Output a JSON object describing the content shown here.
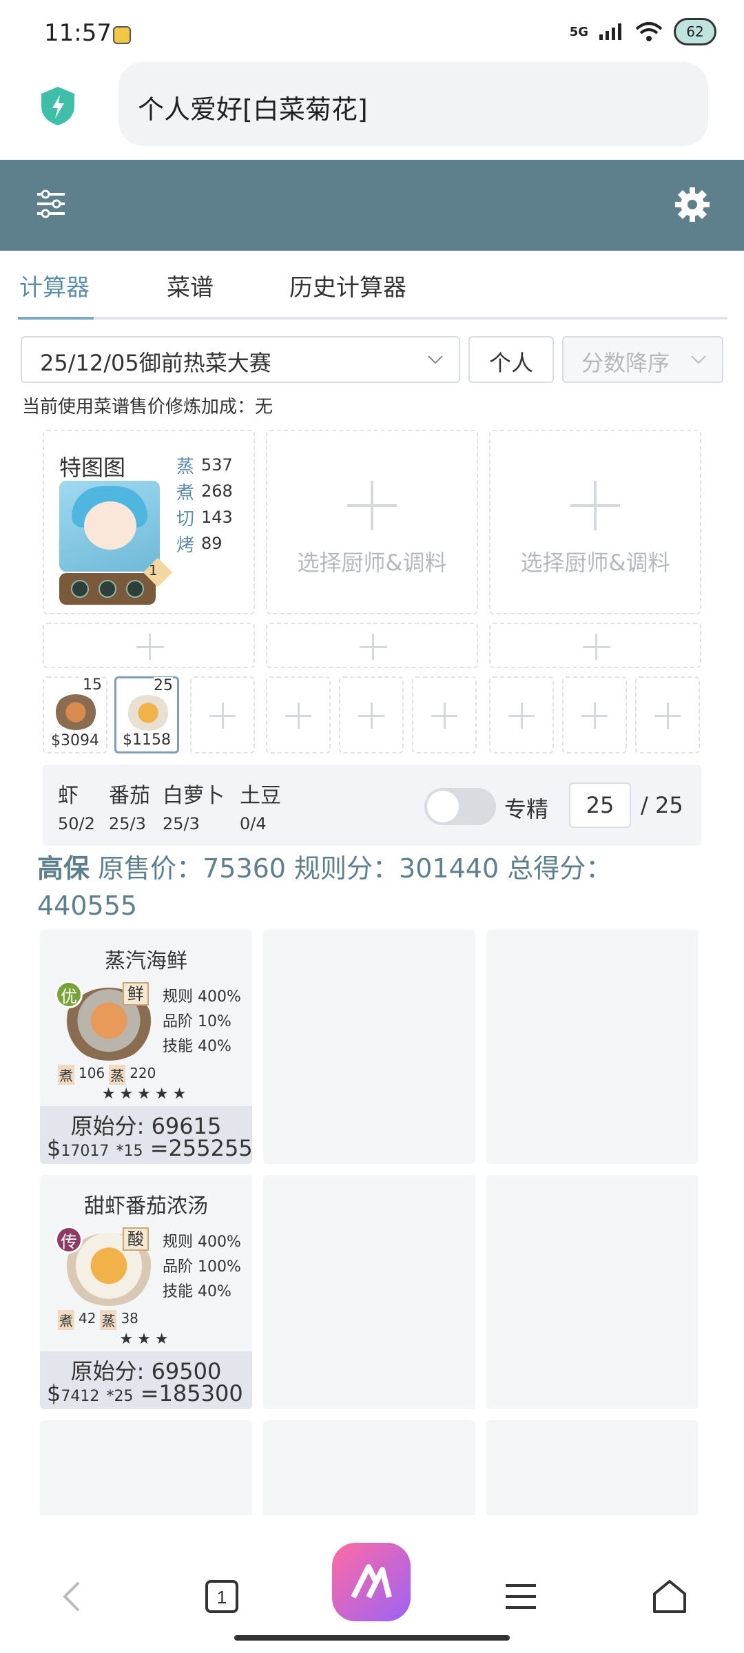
{
  "status": {
    "time": "11:57",
    "network": "5G",
    "battery": "62"
  },
  "browser": {
    "title": "个人爱好[白菜菊花]"
  },
  "tabs": [
    "计算器",
    "菜谱",
    "历史计算器"
  ],
  "filters": {
    "contest": "25/12/05御前热菜大赛",
    "mode": "个人",
    "sort": "分数降序"
  },
  "hint": "当前使用菜谱售价修炼加成：无",
  "chef": {
    "name": "特图图",
    "level": "1",
    "stats": [
      {
        "k": "蒸",
        "v": "537"
      },
      {
        "k": "煮",
        "v": "268"
      },
      {
        "k": "切",
        "v": "143"
      },
      {
        "k": "烤",
        "v": "89"
      }
    ]
  },
  "empty_chef_label": "选择厨师&调料",
  "recipe_slots": [
    {
      "count": "15",
      "price": "$3094"
    },
    {
      "count": "25",
      "price": "$1158"
    }
  ],
  "ingredients": [
    {
      "name": "虾",
      "count": "50/2"
    },
    {
      "name": "番茄",
      "count": "25/3"
    },
    {
      "name": "白萝卜",
      "count": "25/3"
    },
    {
      "name": "土豆",
      "count": "0/4"
    }
  ],
  "specialize": {
    "label": "专精",
    "value": "25",
    "max": "/ 25"
  },
  "score": {
    "prefix": "高保",
    "text": " 原售价：75360 规则分：301440 总得分：",
    "total": "440555"
  },
  "results": [
    {
      "title": "蒸汽海鲜",
      "grade": "优",
      "taste": "鲜",
      "rules": [
        "规则 400%",
        "品阶 10%",
        "技能 40%"
      ],
      "skills": [
        {
          "k": "煮",
          "v": "106"
        },
        {
          "k": "蒸",
          "v": "220"
        }
      ],
      "stars": "★★★★★",
      "orig": "原始分: 69615",
      "price": "17017",
      "mult": "*15",
      "total": "=255255"
    },
    {
      "title": "甜虾番茄浓汤",
      "grade": "传",
      "taste": "酸",
      "rules": [
        "规则 400%",
        "品阶 100%",
        "技能 40%"
      ],
      "skills": [
        {
          "k": "煮",
          "v": "42"
        },
        {
          "k": "蒸",
          "v": "38"
        }
      ],
      "stars": "★★★",
      "orig": "原始分: 69500",
      "price": "7412",
      "mult": "*25",
      "total": "=185300"
    }
  ],
  "colors": {
    "header": "#5e7f8c",
    "accent": "#5d8da8"
  }
}
